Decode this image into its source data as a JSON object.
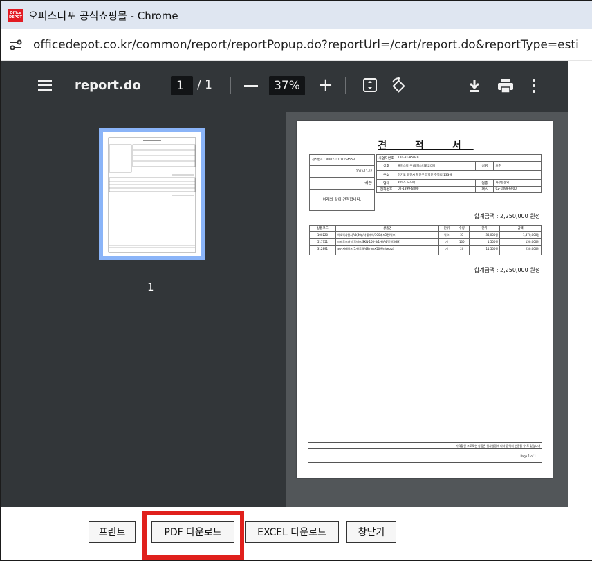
{
  "window": {
    "title": "오피스디포 공식쇼핑몰 - Chrome",
    "logo_text": [
      "Office",
      "DEPOT"
    ],
    "url": "officedepot.co.kr/common/report/reportPopup.do?reportUrl=/cart/report.do&reportType=estimate"
  },
  "viewer": {
    "doc_name": "report.do",
    "current_page": "1",
    "page_sep": "/ 1",
    "zoom": "37%",
    "thumb_label": "1"
  },
  "estimate": {
    "title": "견 적 서",
    "estimate_no": "견적번호 : M20231107154553",
    "date": "2023-11-07",
    "recipient": "귀중",
    "note": "아래와 같이 견적합니다.",
    "supplier": {
      "reg_label": "사업자번호",
      "reg_value": "120-81-85049",
      "company_label": "상호",
      "company_value": "올피스다(주)오피스디포코리아",
      "ceo_label": "성명",
      "ceo_value": "조준",
      "addr_label": "주소",
      "addr_value": "경기도 용인시 처인구 양지면 주북리 133-9",
      "biz_label": "업태",
      "biz_value": "서비스 도소매",
      "type_label": "업종",
      "type_value": "사무용품외",
      "tel_label": "전화번호",
      "tel_value": "02-1899-6800",
      "fax_label": "팩스",
      "fax_value": "02-1899-6900"
    },
    "total_text": "합계금액 : 2,250,000 원정",
    "columns": [
      "상품코드",
      "상품명",
      "단위",
      "수량",
      "단가",
      "금액"
    ],
    "rows": [
      {
        "code": "100220",
        "name": "이오복사용지A4(80g/더블에이/500매×5권/박스)",
        "unit": "박스",
        "qty": "55",
        "price": "34,000원",
        "amount": "1,870,000원"
      },
      {
        "code": "517751",
        "name": "드레투스파일(투비스/SKN-150-5/1개/A4/투명)(GH)",
        "unit": "개",
        "qty": "100",
        "price": "1,500원",
        "amount": "150,000원"
      },
      {
        "code": "312891",
        "name": "포카지테이프(5개/투명/48mm×50M/nicebiz)",
        "unit": "개",
        "qty": "20",
        "price": "11,500원",
        "amount": "230,000원"
      }
    ],
    "footer_note": "가격할인 프로모션 상품은 행사일정에 따라 금액의 변동될 수 도 있습니다",
    "page_num": "Page 1 of 1"
  },
  "buttons": {
    "print": "프린트",
    "pdf": "PDF 다운로드",
    "excel": "EXCEL 다운로드",
    "close": "창닫기"
  },
  "colors": {
    "toolbar": "#323639",
    "viewer_bg": "#525659",
    "thumb_border": "#8ab4f8",
    "highlight": "#e0201c",
    "brand": "#e21b23"
  }
}
